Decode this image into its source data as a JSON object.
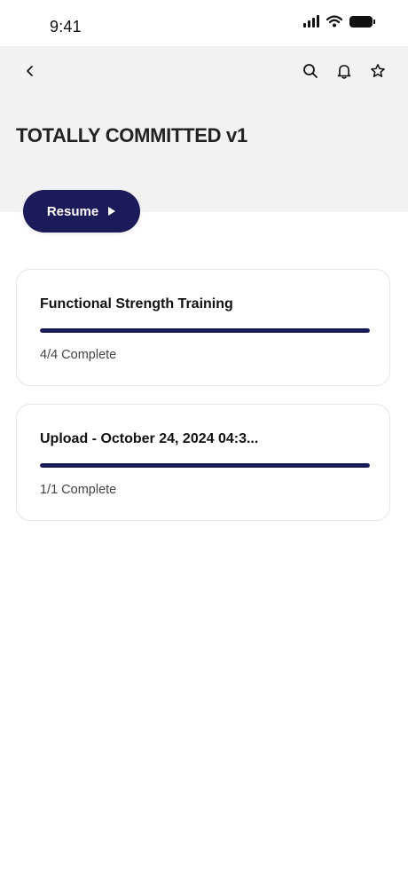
{
  "status_bar": {
    "time": "9:41"
  },
  "header": {
    "title": "TOTALLY COMMITTED v1"
  },
  "actions": {
    "back_icon": "chevron-left-icon",
    "search_icon": "search-icon",
    "bell_icon": "bell-icon",
    "star_icon": "star-icon"
  },
  "resume": {
    "label": "Resume",
    "icon": "play-icon"
  },
  "modules": [
    {
      "title": "Functional Strength Training",
      "status": "4/4 Complete",
      "progress": 1.0
    },
    {
      "title": "Upload - October 24, 2024 04:3...",
      "status": "1/1 Complete",
      "progress": 1.0
    }
  ],
  "colors": {
    "accent": "#1c1b5a",
    "header_bg": "#f2f2f2",
    "card_border": "#e6e6e6"
  }
}
